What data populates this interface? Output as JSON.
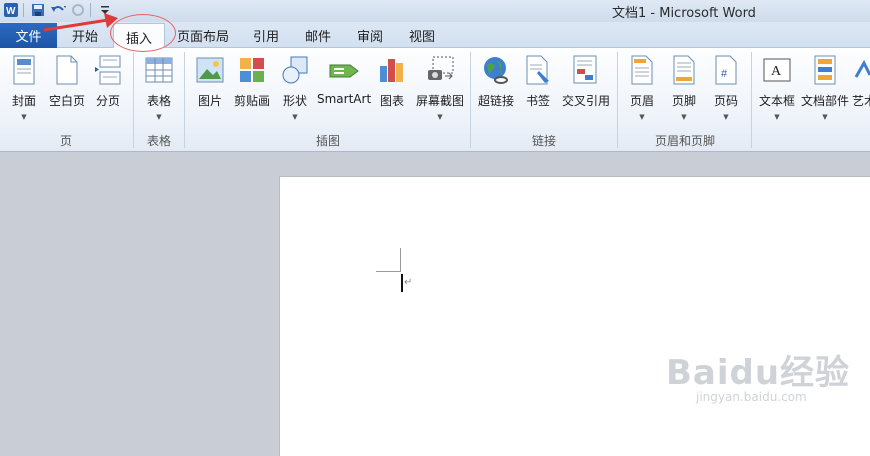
{
  "title": "文档1 - Microsoft Word",
  "colors": {
    "accent": "#1d55a6",
    "annotation": "#e86060",
    "ribbon_bg": "#eef3fa"
  },
  "quick_access": {
    "app_icon": "word-logo-icon",
    "items": [
      "save-icon",
      "undo-icon",
      "redo-icon",
      "customize-dropdown-icon"
    ]
  },
  "tabs": {
    "file": "文件",
    "items": [
      "开始",
      "插入",
      "页面布局",
      "引用",
      "邮件",
      "审阅",
      "视图"
    ],
    "active": "插入"
  },
  "ribbon": {
    "buttons": {
      "cover": "封面",
      "blank_page": "空白页",
      "page_break": "分页",
      "table": "表格",
      "picture": "图片",
      "clipart": "剪贴画",
      "shapes": "形状",
      "smartart": "SmartArt",
      "chart": "图表",
      "screenshot": "屏幕截图",
      "hyperlink": "超链接",
      "bookmark": "书签",
      "cross_ref": "交叉引用",
      "header": "页眉",
      "footer": "页脚",
      "page_number": "页码",
      "textbox": "文本框",
      "quick_parts": "文档部件",
      "wordart": "艺术"
    },
    "groups": {
      "pages": "页",
      "tables": "表格",
      "illustrations": "插图",
      "links": "链接",
      "header_footer": "页眉和页脚"
    }
  },
  "watermark": {
    "brand": "Baidu经验",
    "url": "jingyan.baidu.com"
  }
}
